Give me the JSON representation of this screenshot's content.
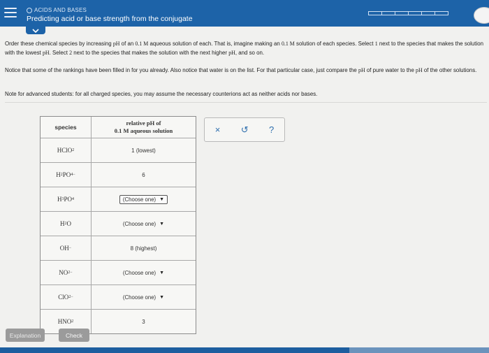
{
  "header": {
    "topic": "ACIDS AND BASES",
    "title": "Predicting acid or base strength from the conjugate",
    "progress_total": 6,
    "progress_done": 0
  },
  "instructions": {
    "p1_a": "Order these chemical species by increasing ",
    "p1_ph": "pH",
    "p1_b": " of an ",
    "p1_conc": "0.1 M",
    "p1_c": " aqueous solution of each. That is, imagine making an ",
    "p1_conc2": "0.1 M",
    "p1_d": " solution of each species. Select ",
    "p1_one": "1",
    "p1_e": " next to the species that makes the solution with the lowest ",
    "p1_ph2": "pH",
    "p1_f": ". Select ",
    "p1_two": "2",
    "p1_g": " next to the species that makes the solution with the next higher ",
    "p1_ph3": "pH",
    "p1_h": ", and so on.",
    "p2_a": "Notice that some of the rankings have been filled in for you already. Also notice that water is on the list. For that particular case, just compare the ",
    "p2_ph": "pH",
    "p2_b": " of pure water to the ",
    "p2_ph2": "pH",
    "p2_c": " of the other solutions.",
    "p3": "Note for advanced students: for all charged species, you may assume the necessary counterions act as neither acids nor bases."
  },
  "table": {
    "col_species": "species",
    "col_rank_line1": "relative pH of",
    "col_rank_line2": "0.1 M aqueous solution",
    "rows": [
      {
        "species_html": "HClO<sub>2</sub>",
        "value": "1 (lowest)",
        "kind": "fixed"
      },
      {
        "species_html": "H<sub>2</sub>PO<sub>4</sub><sup>&minus;</sup>",
        "value": "6",
        "kind": "fixed"
      },
      {
        "species_html": "H<sub>3</sub>PO<sub>4</sub>",
        "value": "(Choose one)",
        "kind": "select-active"
      },
      {
        "species_html": "H<sub>2</sub>O",
        "value": "(Choose one)",
        "kind": "select"
      },
      {
        "species_html": "OH<sup>&minus;</sup>",
        "value": "8 (highest)",
        "kind": "fixed"
      },
      {
        "species_html": "NO<sub>2</sub><sup>&minus;</sup>",
        "value": "(Choose one)",
        "kind": "select"
      },
      {
        "species_html": "ClO<sub>2</sub><sup>&minus;</sup>",
        "value": "(Choose one)",
        "kind": "select"
      },
      {
        "species_html": "HNO<sub>2</sub>",
        "value": "3",
        "kind": "fixed"
      }
    ]
  },
  "tools": {
    "clear": "×",
    "undo": "↺",
    "help": "?"
  },
  "buttons": {
    "explanation": "Explanation",
    "check": "Check"
  },
  "colors": {
    "header_bg": "#1d63a8",
    "button_bg": "#9b9b9b"
  }
}
